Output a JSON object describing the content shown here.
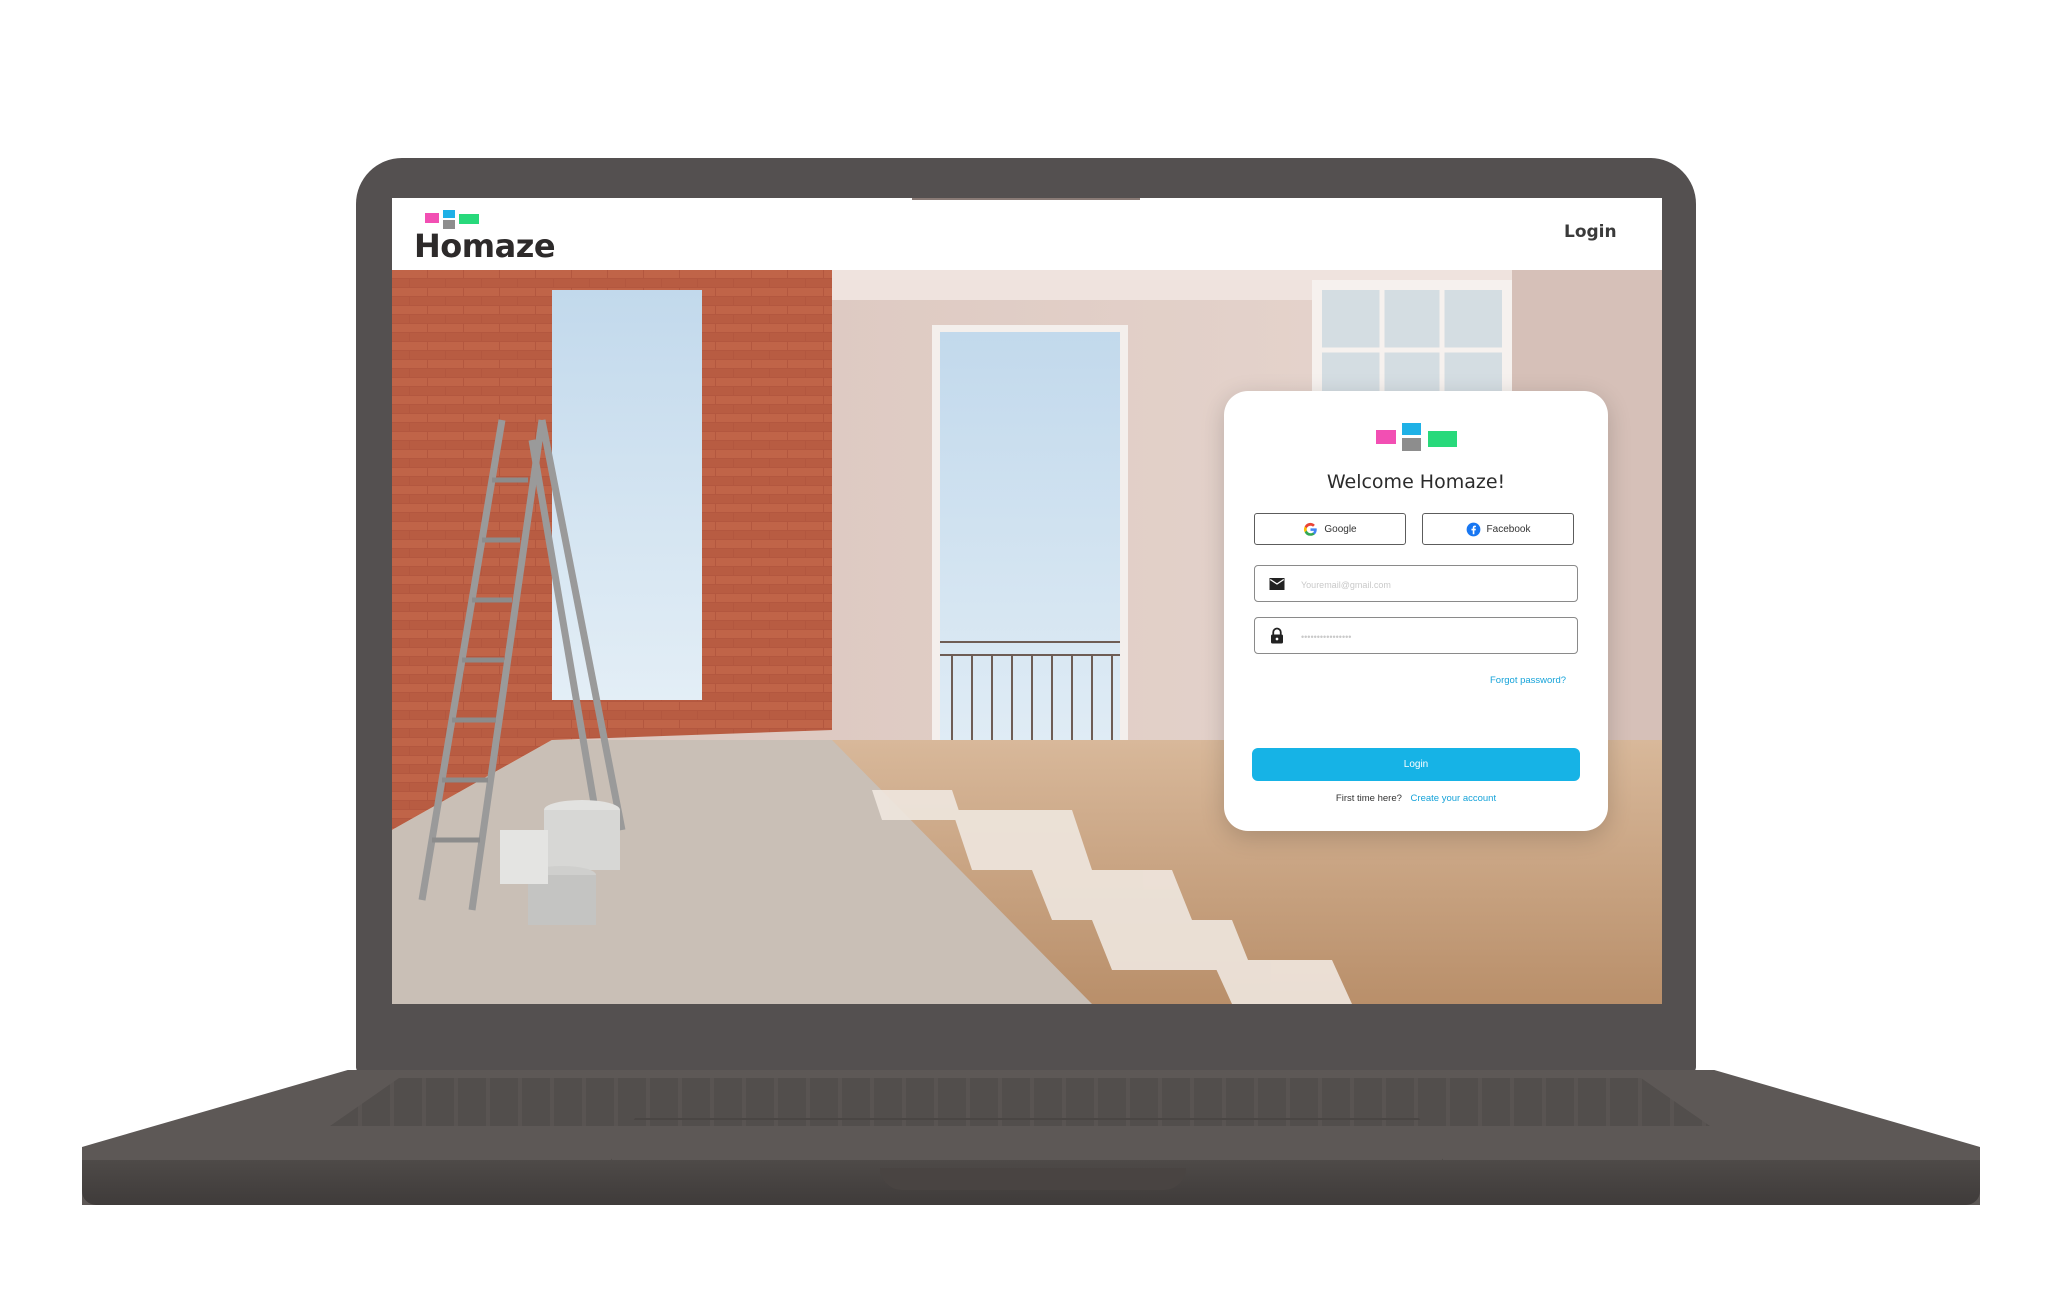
{
  "header": {
    "brand_name": "Homaze",
    "nav_login_label": "Login"
  },
  "login_card": {
    "welcome_title": "Welcome Homaze!",
    "google_label": "Google",
    "facebook_label": "Facebook",
    "email_placeholder": "Youremail@gmail.com",
    "password_placeholder": "••••••••••••••••",
    "forgot_password_label": "Forgot password?",
    "login_button_label": "Login",
    "first_time_text": "First time here?",
    "create_account_label": "Create your account"
  },
  "icons": {
    "email": "mail-icon",
    "password": "lock-icon",
    "google": "google-icon",
    "facebook": "facebook-icon"
  },
  "colors": {
    "brand_pink": "#f24fb3",
    "brand_blue": "#1fb1e6",
    "brand_gray": "#8d8d8d",
    "brand_green": "#28d97b",
    "accent_blue": "#16b3e6",
    "link_blue": "#16a3d9",
    "laptop_body": "#545050"
  }
}
